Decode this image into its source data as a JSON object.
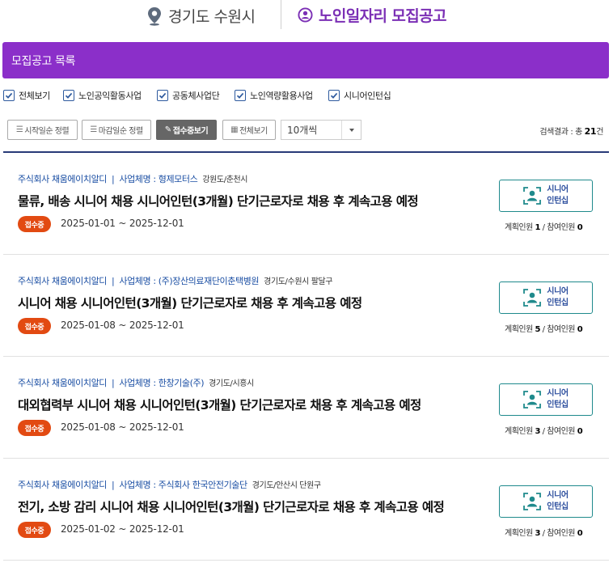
{
  "header": {
    "location": "경기도 수원시",
    "title": "노인일자리 모집공고"
  },
  "list_header": "모집공고 목록",
  "filters": [
    {
      "label": "전체보기",
      "checked": true
    },
    {
      "label": "노인공익활동사업",
      "checked": true
    },
    {
      "label": "공동체사업단",
      "checked": true
    },
    {
      "label": "노인역량활용사업",
      "checked": true
    },
    {
      "label": "시니어인턴십",
      "checked": true
    }
  ],
  "sort_buttons": [
    {
      "label": "시작일순 정렬",
      "icon": "list-icon",
      "active": false
    },
    {
      "label": "마감일순 정렬",
      "icon": "list-icon",
      "active": false
    },
    {
      "label": "접수중보기",
      "icon": "pencil-icon",
      "active": true
    },
    {
      "label": "전체보기",
      "icon": "grid-icon",
      "active": false
    }
  ],
  "page_size": {
    "selected": "10개씩"
  },
  "result": {
    "prefix": "검색결과 : 총 ",
    "count": "21",
    "suffix": "건"
  },
  "accent_colors": {
    "brand": "#8b2fc9",
    "badge": "#e24a12",
    "link": "#1a4ea3",
    "teal": "#1f8a8c"
  },
  "items": [
    {
      "company": "주식회사 채움에이치알디",
      "workplace": "사업체명 : 형제모터스",
      "region": "강원도/춘천시",
      "title": "물류, 배송 시니어 채용 시니어인턴(3개월) 단기근로자로 채용 후 계속고용 예정",
      "status": "접수중",
      "dates": "2025-01-01 ~ 2025-12-01",
      "type_label": "시니어\n인턴십",
      "planned_label": "계획인원",
      "planned": "1",
      "joined_label": "참여인원",
      "joined": "0"
    },
    {
      "company": "주식회사 채움에이치알디",
      "workplace": "사업체명 : (주)장산의료재단이춘택병원",
      "region": "경기도/수원시 팔달구",
      "title": "시니어 채용 시니어인턴(3개월) 단기근로자로 채용 후 계속고용 예정",
      "status": "접수중",
      "dates": "2025-01-08 ~ 2025-12-01",
      "type_label": "시니어\n인턴십",
      "planned_label": "계획인원",
      "planned": "5",
      "joined_label": "참여인원",
      "joined": "0"
    },
    {
      "company": "주식회사 채움에이치알디",
      "workplace": "사업체명 : 한창기술(주)",
      "region": "경기도/시흥시",
      "title": "대외협력부 시니어 채용 시니어인턴(3개월) 단기근로자로 채용 후 계속고용 예정",
      "status": "접수중",
      "dates": "2025-01-08 ~ 2025-12-01",
      "type_label": "시니어\n인턴십",
      "planned_label": "계획인원",
      "planned": "3",
      "joined_label": "참여인원",
      "joined": "0"
    },
    {
      "company": "주식회사 채움에이치알디",
      "workplace": "사업체명 : 주식회사 한국안전기술단",
      "region": "경기도/안산시 단원구",
      "title": "전기, 소방 감리 시니어 채용 시니어인턴(3개월) 단기근로자로 채용 후 계속고용 예정",
      "status": "접수중",
      "dates": "2025-01-02 ~ 2025-12-01",
      "type_label": "시니어\n인턴십",
      "planned_label": "계획인원",
      "planned": "3",
      "joined_label": "참여인원",
      "joined": "0"
    }
  ]
}
